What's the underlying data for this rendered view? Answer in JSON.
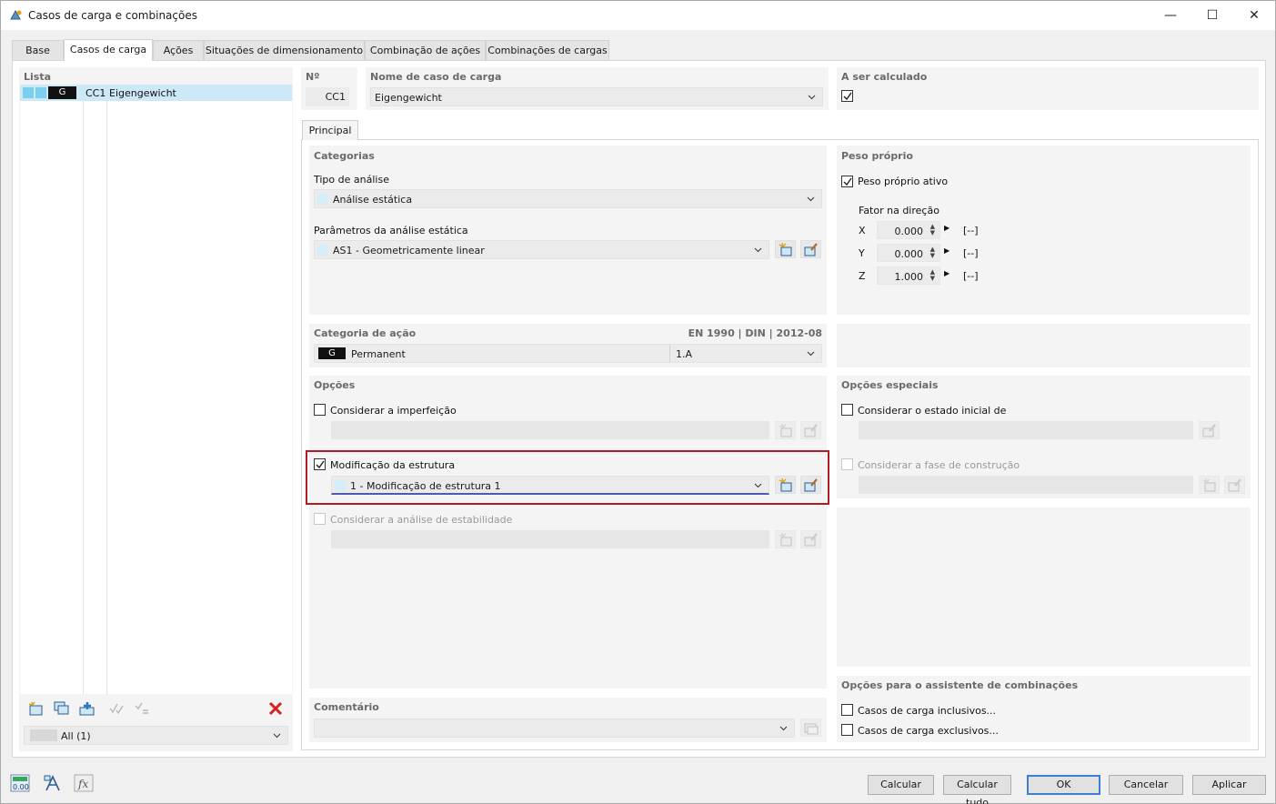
{
  "window": {
    "title": "Casos de carga e combinações",
    "minimize": "—",
    "maximize": "☐",
    "close": "✕"
  },
  "tabs": [
    "Base",
    "Casos de carga",
    "Ações",
    "Situações de dimensionamento",
    "Combinação de ações",
    "Combinações de cargas"
  ],
  "list": {
    "header": "Lista",
    "items": [
      {
        "badge": "G",
        "id": "CC1",
        "name": "Eigengewicht"
      }
    ],
    "filter": "All (1)"
  },
  "lc": {
    "no_header": "Nº",
    "no_value": "CC1",
    "name_header": "Nome de caso de carga",
    "name_value": "Eigengewicht",
    "calc_header": "A ser calculado"
  },
  "subtab": "Principal",
  "categories": {
    "header": "Categorias",
    "analysis_label": "Tipo de análise",
    "analysis_value": "Análise estática",
    "params_label": "Parâmetros da análise estática",
    "params_value": "AS1 - Geometricamente linear"
  },
  "selfweight": {
    "header": "Peso próprio",
    "active_label": "Peso próprio ativo",
    "factor_label": "Fator na direção",
    "rows": [
      {
        "axis": "X",
        "value": "0.000",
        "unit": "[--]"
      },
      {
        "axis": "Y",
        "value": "0.000",
        "unit": "[--]"
      },
      {
        "axis": "Z",
        "value": "1.000",
        "unit": "[--]"
      }
    ]
  },
  "action": {
    "header": "Categoria de ação",
    "norm": "EN 1990 | DIN | 2012-08",
    "badge": "G",
    "value": "Permanent",
    "code": "1.A"
  },
  "options": {
    "header": "Opções",
    "imperfection": "Considerar a imperfeição",
    "modification": "Modificação da estrutura",
    "modification_value": "1 - Modificação de estrutura 1",
    "stability": "Considerar a análise de estabilidade"
  },
  "special": {
    "header": "Opções especiais",
    "initial_state": "Considerar o estado inicial de",
    "construction": "Considerar a fase de construção"
  },
  "comment": {
    "header": "Comentário"
  },
  "wizard": {
    "header": "Opções para o assistente de combinações",
    "inclusive": "Casos de carga inclusivos...",
    "exclusive": "Casos de carga exclusivos..."
  },
  "footer": {
    "calc": "Calcular",
    "calc_all": "Calcular tudo",
    "ok": "OK",
    "cancel": "Cancelar",
    "apply": "Aplicar",
    "units_icon_text": "0.00"
  },
  "colors": {
    "highlight_border": "#b01c24",
    "selection": "#cde8f7",
    "accent": "#3c7fd4"
  }
}
